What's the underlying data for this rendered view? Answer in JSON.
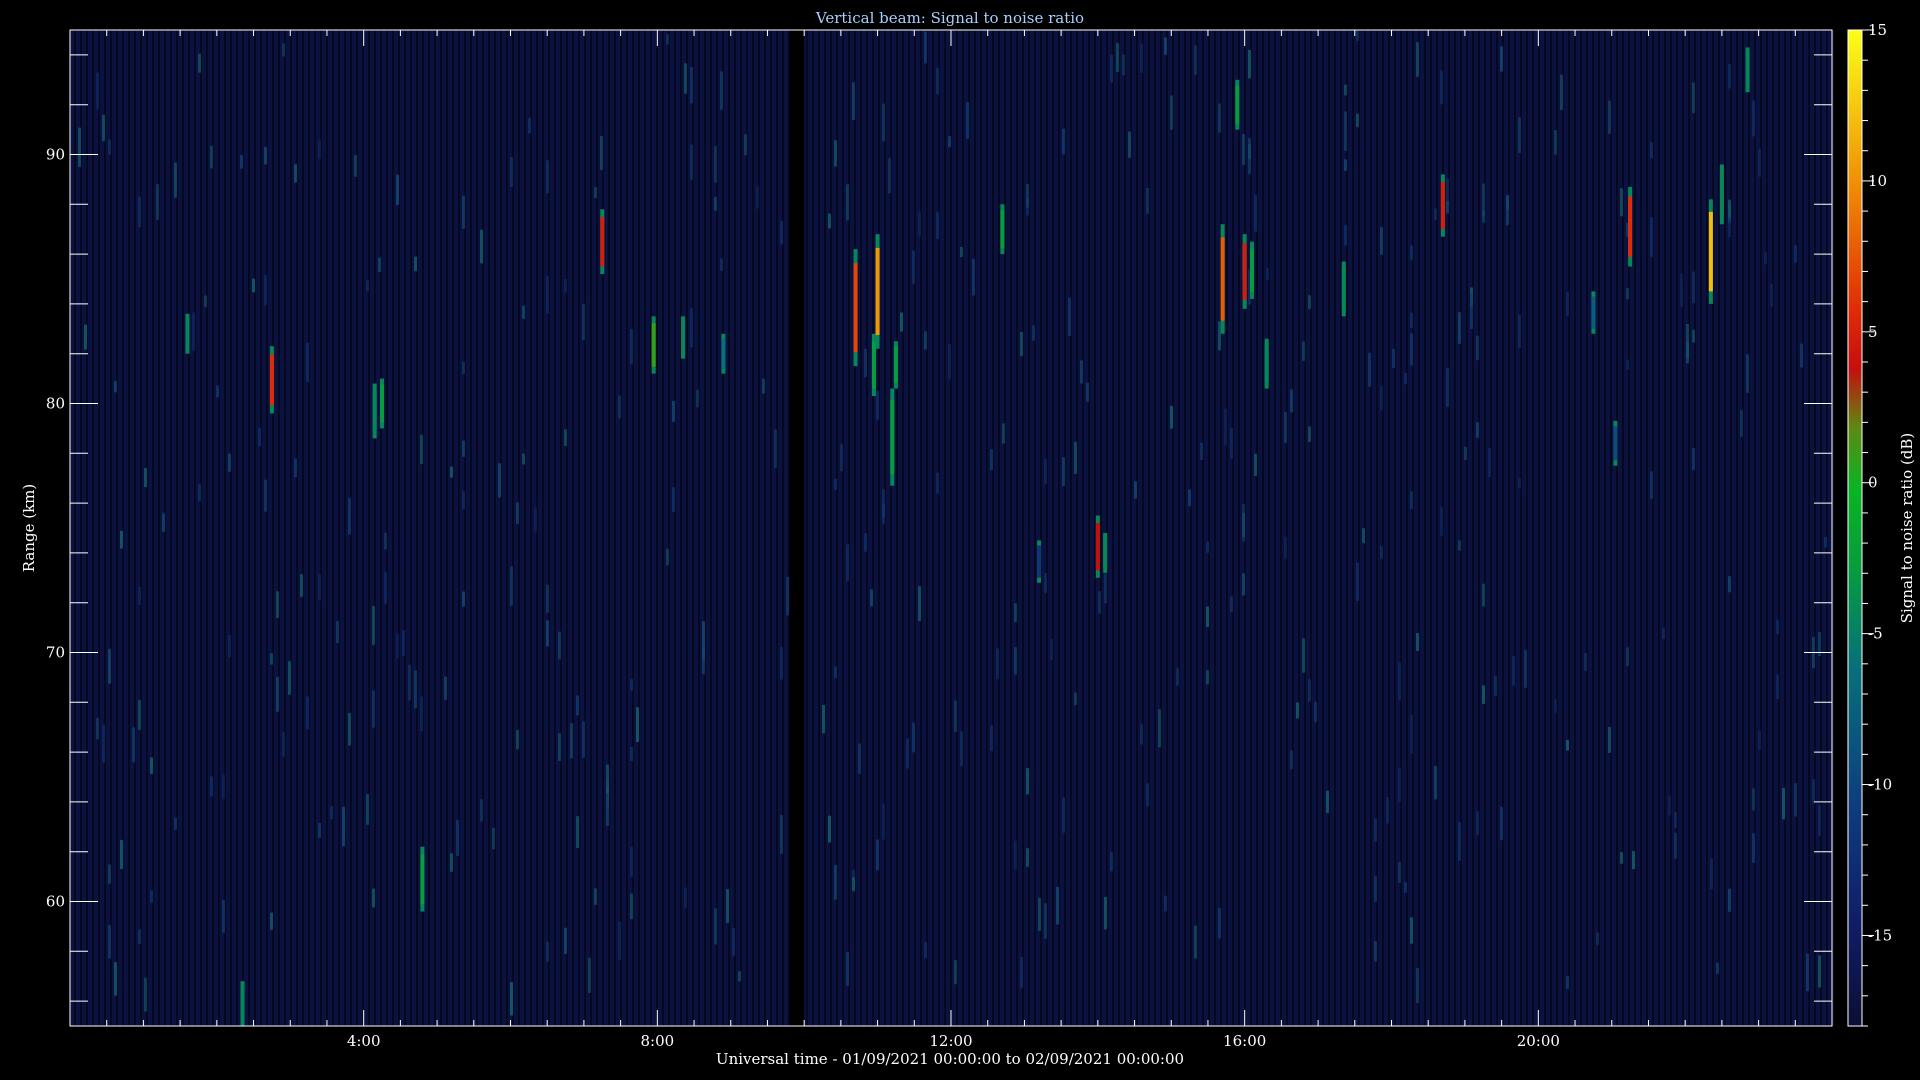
{
  "chart_data": {
    "type": "heatmap",
    "title": "Vertical beam: Signal to noise ratio",
    "xlabel": "Universal time - 01/09/2021 00:00:00 to 02/09/2021 00:00:00",
    "ylabel": "Range (km)",
    "colorbar_label": "Signal to noise ratio (dB)",
    "xlim_hours": [
      0,
      24
    ],
    "ylim_km": [
      55,
      95
    ],
    "x_ticks": [
      {
        "hour": 4,
        "label": "4:00"
      },
      {
        "hour": 8,
        "label": "8:00"
      },
      {
        "hour": 12,
        "label": "12:00"
      },
      {
        "hour": 16,
        "label": "16:00"
      },
      {
        "hour": 20,
        "label": "20:00"
      }
    ],
    "y_ticks": [
      {
        "km": 60,
        "label": "60"
      },
      {
        "km": 70,
        "label": "70"
      },
      {
        "km": 80,
        "label": "80"
      },
      {
        "km": 90,
        "label": "90"
      }
    ],
    "colorbar_range_db": [
      -18,
      15
    ],
    "colorbar_ticks": [
      {
        "db": 15,
        "label": "15"
      },
      {
        "db": 10,
        "label": "10"
      },
      {
        "db": 5,
        "label": "5"
      },
      {
        "db": 0,
        "label": "0"
      },
      {
        "db": -5,
        "label": "-5"
      },
      {
        "db": -10,
        "label": "-10"
      },
      {
        "db": -15,
        "label": "-15"
      }
    ],
    "background_snr_db": -16,
    "data_gap_hours": [
      9.8,
      10.0
    ],
    "echoes": [
      {
        "hour": 1.6,
        "range_km": [
          82,
          83.6
        ],
        "snr_db": -6
      },
      {
        "hour": 2.35,
        "range_km": [
          55,
          56.8
        ],
        "snr_db": -6
      },
      {
        "hour": 2.75,
        "range_km": [
          79.6,
          82.3
        ],
        "snr_db": 2
      },
      {
        "hour": 4.15,
        "range_km": [
          78.6,
          80.8
        ],
        "snr_db": -6
      },
      {
        "hour": 4.25,
        "range_km": [
          79,
          81
        ],
        "snr_db": -5
      },
      {
        "hour": 4.8,
        "range_km": [
          59.6,
          62.2
        ],
        "snr_db": -5
      },
      {
        "hour": 7.25,
        "range_km": [
          85.2,
          87.8
        ],
        "snr_db": 1
      },
      {
        "hour": 7.95,
        "range_km": [
          81.2,
          83.5
        ],
        "snr_db": -2
      },
      {
        "hour": 8.35,
        "range_km": [
          81.8,
          83.5
        ],
        "snr_db": -6
      },
      {
        "hour": 8.9,
        "range_km": [
          81.2,
          82.8
        ],
        "snr_db": -7
      },
      {
        "hour": 10.7,
        "range_km": [
          81.5,
          86.2
        ],
        "snr_db": 3
      },
      {
        "hour": 10.95,
        "range_km": [
          80.3,
          82.8
        ],
        "snr_db": -5
      },
      {
        "hour": 11.0,
        "range_km": [
          82.2,
          86.8
        ],
        "snr_db": 7
      },
      {
        "hour": 11.2,
        "range_km": [
          76.7,
          80.6
        ],
        "snr_db": -5
      },
      {
        "hour": 11.25,
        "range_km": [
          80.6,
          82.5
        ],
        "snr_db": -5
      },
      {
        "hour": 12.7,
        "range_km": [
          86,
          88
        ],
        "snr_db": -5
      },
      {
        "hour": 14.0,
        "range_km": [
          73,
          75.5
        ],
        "snr_db": 0
      },
      {
        "hour": 14.1,
        "range_km": [
          73.2,
          74.8
        ],
        "snr_db": -6
      },
      {
        "hour": 15.7,
        "range_km": [
          82.8,
          87.2
        ],
        "snr_db": 4
      },
      {
        "hour": 15.9,
        "range_km": [
          91,
          93
        ],
        "snr_db": -5
      },
      {
        "hour": 16.0,
        "range_km": [
          83.8,
          86.8
        ],
        "snr_db": 1
      },
      {
        "hour": 16.1,
        "range_km": [
          84.2,
          86.5
        ],
        "snr_db": -5
      },
      {
        "hour": 16.3,
        "range_km": [
          80.6,
          82.6
        ],
        "snr_db": -6
      },
      {
        "hour": 17.35,
        "range_km": [
          83.5,
          85.7
        ],
        "snr_db": -6
      },
      {
        "hour": 18.7,
        "range_km": [
          86.7,
          89.2
        ],
        "snr_db": 1
      },
      {
        "hour": 21.25,
        "range_km": [
          85.5,
          88.7
        ],
        "snr_db": 2
      },
      {
        "hour": 22.35,
        "range_km": [
          84,
          88.2
        ],
        "snr_db": 10
      },
      {
        "hour": 22.5,
        "range_km": [
          87.2,
          89.6
        ],
        "snr_db": -6
      },
      {
        "hour": 22.85,
        "range_km": [
          92.5,
          94.3
        ],
        "snr_db": -6
      },
      {
        "hour": 20.75,
        "range_km": [
          82.8,
          84.5
        ],
        "snr_db": -8
      },
      {
        "hour": 21.05,
        "range_km": [
          77.5,
          79.3
        ],
        "snr_db": -9
      },
      {
        "hour": 13.2,
        "range_km": [
          72.8,
          74.5
        ],
        "snr_db": -11
      }
    ]
  }
}
